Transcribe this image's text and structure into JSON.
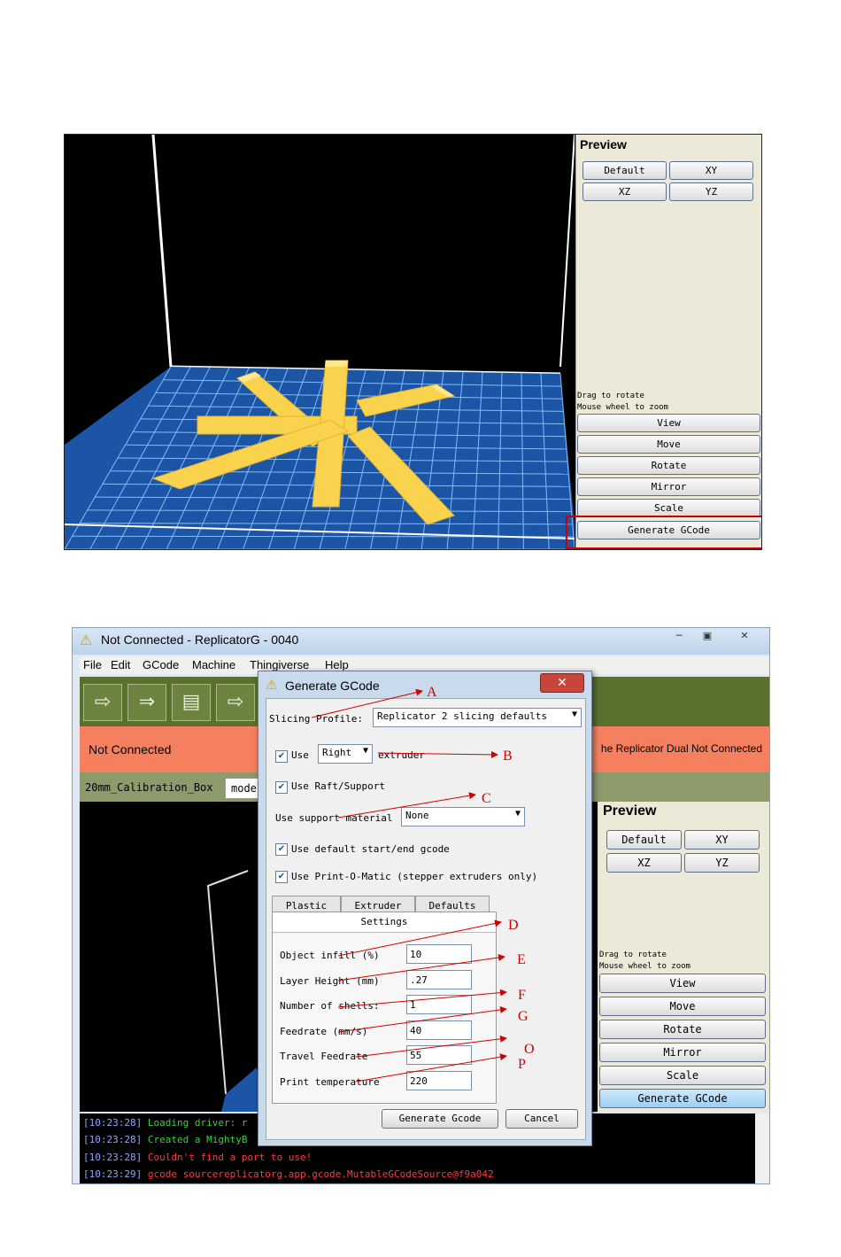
{
  "shot1": {
    "panel_title": "Preview",
    "view_buttons": [
      "Default",
      "XY",
      "XZ",
      "YZ"
    ],
    "hints": [
      "Drag to rotate",
      "Mouse wheel to zoom"
    ],
    "tool_buttons": [
      "View",
      "Move",
      "Rotate",
      "Mirror",
      "Scale",
      "Generate GCode"
    ]
  },
  "shot2": {
    "window_title": "Not Connected - ReplicatorG - 0040",
    "menu": [
      "File",
      "Edit",
      "GCode",
      "Machine",
      "Thingiverse",
      "Help"
    ],
    "status_left": "Not Connected",
    "status_right": "he Replicator Dual Not Connected",
    "file_tab": "20mm_Calibration_Box",
    "file_tab2": "model",
    "panel_title": "Preview",
    "view_buttons": [
      "Default",
      "XY",
      "XZ",
      "YZ"
    ],
    "hints": [
      "Drag to rotate",
      "Mouse wheel to zoom"
    ],
    "tool_buttons": [
      "View",
      "Move",
      "Rotate",
      "Mirror",
      "Scale",
      "Generate GCode"
    ],
    "console": [
      {
        "time": "[10:23:28]",
        "text": "Loading driver: r",
        "color": "#3ccf3c"
      },
      {
        "time": "[10:23:28]",
        "text": "Created a MightyB",
        "color": "#3ccf3c"
      },
      {
        "time": "[10:23:28]",
        "text": "Couldn't find a port to use!",
        "color": "#ff3a3a"
      },
      {
        "time": "[10:23:29]",
        "text": "gcode sourcereplicatorg.app.gcode.MutableGCodeSource@f9a042",
        "color": "#ff3a3a"
      }
    ]
  },
  "dialog": {
    "title": "Generate GCode",
    "slicing_profile_label": "Slicing Profile:",
    "slicing_profile_value": "Replicator 2 slicing defaults",
    "use_label": "Use",
    "extruder_value": "Right",
    "extruder_label": "extruder",
    "raft_label": "Use Raft/Support",
    "support_label": "Use support material",
    "support_value": "None",
    "default_gcode_label": "Use default start/end gcode",
    "printomatic_label": "Use Print-O-Matic (stepper extruders only)",
    "tabs": [
      "Plastic",
      "Extruder",
      "Defaults",
      "Settings"
    ],
    "fields": [
      {
        "label": "Object infill (%)",
        "value": "10"
      },
      {
        "label": "Layer Height (mm)",
        "value": ".27"
      },
      {
        "label": "Number of shells:",
        "value": "1"
      },
      {
        "label": "Feedrate (mm/s)",
        "value": "40"
      },
      {
        "label": "Travel Feedrate",
        "value": "55"
      },
      {
        "label": "Print temperature",
        "value": "220"
      }
    ],
    "generate_button": "Generate Gcode",
    "cancel_button": "Cancel"
  },
  "annotations": [
    "A",
    "B",
    "C",
    "D",
    "E",
    "F",
    "G",
    "O",
    "P"
  ]
}
